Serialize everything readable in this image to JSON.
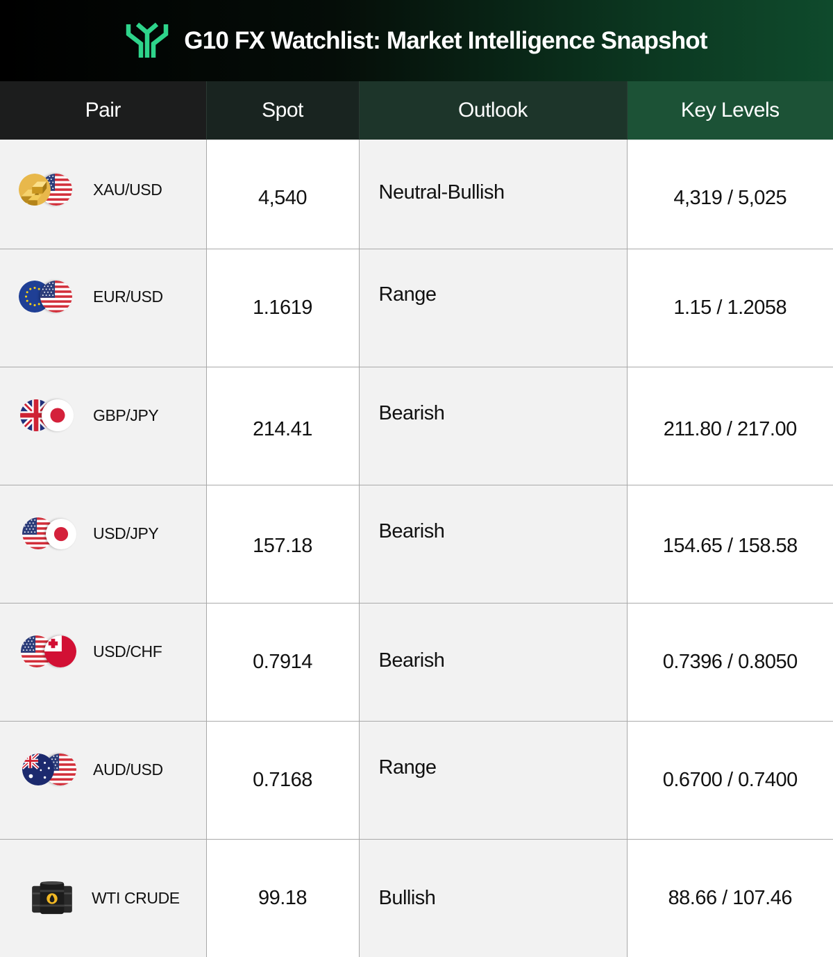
{
  "header": {
    "title": "G10 FX Watchlist: Market Intelligence Snapshot",
    "logo_icon": "gallery-logo-icon",
    "accent": "#2ed48b"
  },
  "columns": [
    "Pair",
    "Spot",
    "Outlook",
    "Key Levels"
  ],
  "rows": [
    {
      "pair": "XAU/USD",
      "spot": "4,540",
      "outlook": "Neutral-Bullish",
      "levels": "4,319 / 5,025",
      "icons": [
        "gold-bars-icon",
        "us-flag-icon"
      ]
    },
    {
      "pair": "EUR/USD",
      "spot": "1.1619",
      "outlook": "Range",
      "levels": "1.15 / 1.2058",
      "icons": [
        "eu-flag-icon",
        "us-flag-icon"
      ]
    },
    {
      "pair": "GBP/JPY",
      "spot": "214.41",
      "outlook": "Bearish",
      "levels": "211.80 / 217.00",
      "icons": [
        "uk-flag-icon",
        "japan-flag-icon"
      ]
    },
    {
      "pair": "USD/JPY",
      "spot": "157.18",
      "outlook": "Bearish",
      "levels": "154.65 / 158.58",
      "icons": [
        "us-flag-icon",
        "japan-flag-icon"
      ]
    },
    {
      "pair": "USD/CHF",
      "spot": "0.7914",
      "outlook": "Bearish",
      "levels": "0.7396 / 0.8050",
      "icons": [
        "us-flag-icon",
        "tonga-flag-icon"
      ]
    },
    {
      "pair": "AUD/USD",
      "spot": "0.7168",
      "outlook": "Range",
      "levels": "0.6700 / 0.7400",
      "icons": [
        "australia-flag-icon",
        "us-flag-icon"
      ]
    },
    {
      "pair": "WTI CRUDE",
      "spot": "99.18",
      "outlook": "Bullish",
      "levels": "88.66 / 107.46",
      "icons": [
        "oil-barrels-icon"
      ]
    }
  ]
}
